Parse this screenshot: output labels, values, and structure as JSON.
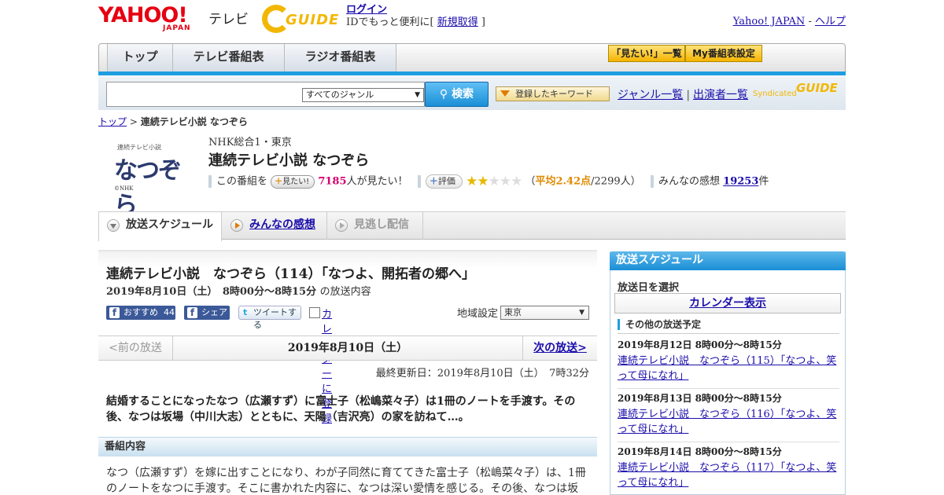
{
  "header": {
    "yahoo_logo": "YAHOO!",
    "yahoo_sub": "JAPAN",
    "tv_label": "テレビ",
    "gguide_logo": "GUIDE",
    "login_link": "ログイン",
    "login_text": "IDでもっと便利に[ ",
    "signup_link": "新規取得",
    "login_close": " ]",
    "yahoo_japan_link": "Yahoo! JAPAN",
    "link_sep": " - ",
    "help_link": "ヘルプ"
  },
  "nav": {
    "tabs": [
      {
        "label": "トップ"
      },
      {
        "label": "テレビ番組表"
      },
      {
        "label": "ラジオ番組表"
      }
    ],
    "mitai_list": "「見たい!」一覧",
    "my_schedule": "My番組表設定"
  },
  "search": {
    "placeholder": "",
    "genre_selected": "すべてのジャンル",
    "search_button": "検索",
    "keyword_button": "登録したキーワード",
    "genre_list_link": "ジャンル一覧",
    "sep": "|",
    "cast_list_link": "出演者一覧",
    "syndicated": "Syndicated",
    "syndicated_logo": "GUIDE"
  },
  "breadcrumb": {
    "top": "トップ",
    "sep": " > ",
    "current": "連続テレビ小説 なつぞら"
  },
  "program": {
    "thumb_small": "連続テレビ小説",
    "thumb_title": "なつぞら",
    "thumb_copy": "©NHK",
    "station": "NHK総合1・東京",
    "title": "連続テレビ小説 なつぞら",
    "mitai_prefix": "この番組を",
    "mitai_button": "見たい!",
    "mitai_count": "7185",
    "mitai_suffix": "人が見たい！",
    "rating_button": "評価",
    "rating_value": 2.42,
    "rating_open": "（",
    "rating_avg": "平均2.42点",
    "rating_people": "/2299人）",
    "comments_label": "みんなの感想",
    "comments_count": "19253",
    "comments_unit": "件"
  },
  "subtabs": [
    {
      "label": "放送スケジュール"
    },
    {
      "label": "みんなの感想"
    },
    {
      "label": "見逃し配信"
    }
  ],
  "episode": {
    "title": "連続テレビ小説　なつぞら（114）「なつよ、開拓者の郷へ」",
    "datetime": "2019年8月10日（土）　8時00分～8時15分",
    "datetime_suffix": "の放送内容",
    "recommend": "おすすめ",
    "recommend_count": "44",
    "share": "シェア",
    "tweet": "ツイートする",
    "calendar_register": "カレンダーに登録",
    "region_label": "地域設定",
    "region_selected": "東京",
    "prev": "<前の放送",
    "current_day": "2019年8月10日（土）",
    "next": "次の放送>",
    "updated": "最終更新日：2019年8月10日（土）　7時32分",
    "summary": "結婚することになったなつ（広瀬すず）に富士子（松嶋菜々子）は1冊のノートを手渡す。その後、なつは坂場（中川大志）とともに、天陽（吉沢亮）の家を訪ねて…。",
    "section_title": "番組内容",
    "section_body": "なつ（広瀬すず）を嫁に出すことになり、わが子同然に育ててきた富士子（松嶋菜々子）は、1冊のノートをなつに手渡す。そこに書かれた内容に、なつは深い愛情を感じる。その後、なつは坂"
  },
  "sidebar": {
    "title": "放送スケジュール",
    "select_date": "放送日を選択",
    "calendar_button": "カレンダー表示",
    "other_title": "その他の放送予定",
    "items": [
      {
        "date": "2019年8月12日  8時00分～8時15分",
        "title": "連続テレビ小説　なつぞら（115）「なつよ、笑って母になれ」"
      },
      {
        "date": "2019年8月13日  8時00分～8時15分",
        "title": "連続テレビ小説　なつぞら（116）「なつよ、笑って母になれ」"
      },
      {
        "date": "2019年8月14日  8時00分～8時15分",
        "title": "連続テレビ小説　なつぞら（117）「なつよ、笑って母になれ」"
      }
    ]
  },
  "colors": {
    "accent_blue": "#1e9de0",
    "brand_red": "#e60012",
    "gguide_yellow": "#f2b705",
    "mitai_pink": "#d6006f"
  }
}
